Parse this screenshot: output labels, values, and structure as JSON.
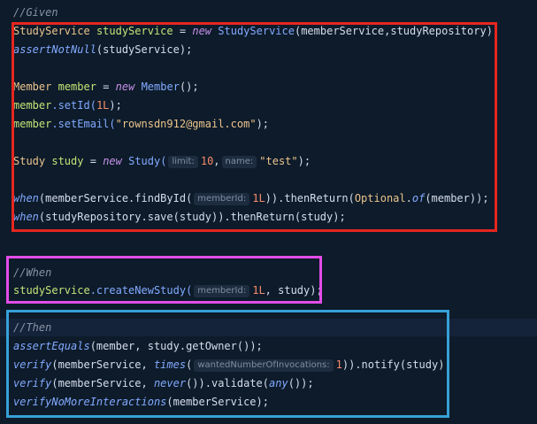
{
  "given": {
    "comment": "//Given",
    "lines": {
      "l1": {
        "type": "StudyService",
        "var": "studyService",
        "op": "=",
        "kw": "new",
        "ctor": "StudyService",
        "args": "(memberService,studyRepository);"
      },
      "l2": {
        "fn": "assertNotNull",
        "args": "(studyService);"
      },
      "l3": {
        "type": "Member",
        "var": "member",
        "op": "=",
        "kw": "new",
        "ctor": "Member",
        "args": "();"
      },
      "l4": {
        "obj": "member",
        "method": ".setId(",
        "num": "1L",
        "end": ");"
      },
      "l5": {
        "obj": "member",
        "method": ".setEmail(",
        "str": "\"rownsdn912@gmail.com\"",
        "end": ");"
      },
      "l6": {
        "type": "Study",
        "var": "study",
        "op": "=",
        "kw": "new",
        "ctor": "Study(",
        "hint1": "limit:",
        "num": "10",
        "sep": ",",
        "hint2": "name:",
        "str": "\"test\"",
        "end": ");"
      },
      "l7": {
        "fn": "when",
        "a": "(memberService.findById(",
        "hint": "memberId:",
        "num": "1L",
        "b": ")).thenReturn(",
        "type": "Optional",
        "fn2": "of",
        "c": "(member));"
      },
      "l8": {
        "fn": "when",
        "a": "(studyRepository.save(study)).thenReturn(study);"
      }
    }
  },
  "when": {
    "comment": "//When",
    "line": {
      "obj": "studyService",
      "method": ".createNewStudy(",
      "hint": "memberId:",
      "num": "1L",
      "end": ", study);"
    }
  },
  "then": {
    "comment": "//Then",
    "lines": {
      "l1": {
        "fn": "assertEquals",
        "a": "(member, study.getOwner());"
      },
      "l2": {
        "fn": "verify",
        "a": "(memberService, ",
        "fn2": "times",
        "b": "(",
        "hint": "wantedNumberOfInvocations:",
        "num": "1",
        "c": ")).notify(study);"
      },
      "l3": {
        "fn": "verify",
        "a": "(memberService, ",
        "fn2": "never",
        "b": "()).validate(",
        "fn3": "any",
        "c": "());"
      },
      "l4": {
        "fn": "verifyNoMoreInteractions",
        "a": "(memberService);"
      }
    }
  },
  "colors": {
    "background": "#0d1b2a",
    "given_box": "#e6261f",
    "when_box": "#e34ce8",
    "then_box": "#37a0d7"
  }
}
